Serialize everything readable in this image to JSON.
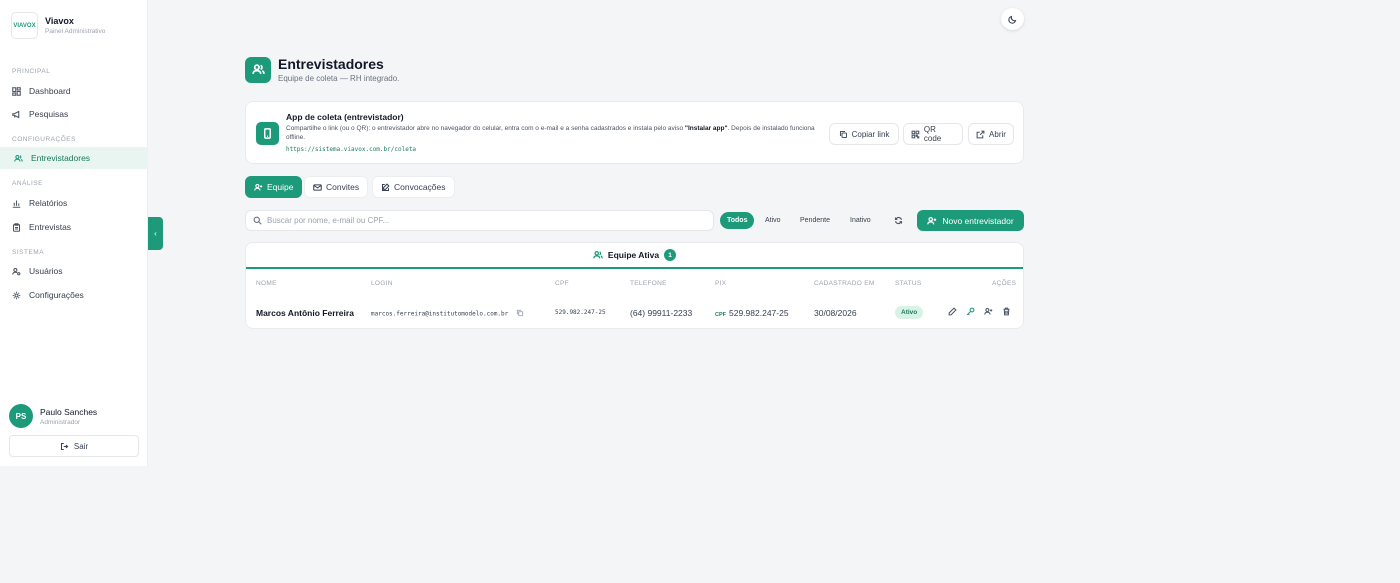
{
  "brand": {
    "logo_text": "VIAVOX",
    "name": "Viavox",
    "subtitle": "Painel Administrativo"
  },
  "sidebar": {
    "sections": [
      {
        "label": "PRINCIPAL"
      },
      {
        "label": "CONFIGURAÇÕES"
      },
      {
        "label": "ANÁLISE"
      },
      {
        "label": "SISTEMA"
      }
    ],
    "items": [
      {
        "label": "Dashboard",
        "icon": "dashboard-icon"
      },
      {
        "label": "Pesquisas",
        "icon": "megaphone-icon"
      },
      {
        "label": "Entrevistadores",
        "icon": "users-icon",
        "active": true
      },
      {
        "label": "Relatórios",
        "icon": "bar-chart-icon"
      },
      {
        "label": "Entrevistas",
        "icon": "clipboard-icon"
      },
      {
        "label": "Usuários",
        "icon": "user-cog-icon"
      },
      {
        "label": "Configurações",
        "icon": "gear-icon"
      }
    ],
    "user": {
      "initials": "PS",
      "name": "Paulo Sanches",
      "role": "Administrador"
    },
    "logout_label": "Sair",
    "collapse_glyph": "‹"
  },
  "header": {
    "title": "Entrevistadores",
    "subtitle": "Equipe de coleta — RH integrado."
  },
  "app_card": {
    "title": "App de coleta (entrevistador)",
    "desc_part1": "Compartilhe o link (ou o QR): o entrevistador abre no navegador do celular, entra com o e-mail e a senha cadastrados e instala pelo aviso ",
    "desc_bold": "\"Instalar app\"",
    "desc_part2": ". Depois de instalado funciona offline.",
    "link": "https://sistema.viavox.com.br/coleta",
    "copy_label": "Copiar link",
    "qr_label": "QR code",
    "open_label": "Abrir"
  },
  "tabs": [
    {
      "label": "Equipe",
      "active": true
    },
    {
      "label": "Convites"
    },
    {
      "label": "Convocações"
    }
  ],
  "search": {
    "placeholder": "Buscar por nome, e-mail ou CPF..."
  },
  "filters": [
    "Todos",
    "Ativo",
    "Pendente",
    "Inativo"
  ],
  "new_button_label": "Novo entrevistador",
  "team": {
    "title": "Equipe Ativa",
    "count": "1"
  },
  "table": {
    "columns": [
      "NOME",
      "LOGIN",
      "CPF",
      "TELEFONE",
      "PIX",
      "CADASTRADO EM",
      "STATUS",
      "AÇÕES"
    ],
    "rows": [
      {
        "nome": "Marcos Antônio Ferreira",
        "login": "marcos.ferreira@institutomodelo.com.br",
        "cpf": "529.982.247-25",
        "telefone": "(64) 99911-2233",
        "pix_type": "CPF",
        "pix": "529.982.247-25",
        "cadastrado": "30/08/2026",
        "status": "Ativo"
      }
    ]
  },
  "colors": {
    "accent": "#1d9a7a",
    "accent_light": "#e8f5f0",
    "background": "#f4f5f7"
  }
}
